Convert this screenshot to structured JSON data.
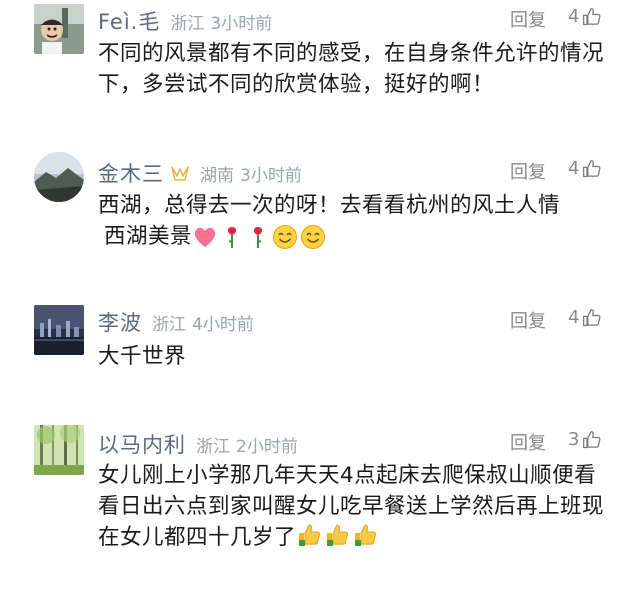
{
  "comments": [
    {
      "name": "Feì.毛",
      "location": "浙江",
      "time": "3小时前",
      "reply_label": "回复",
      "likes": "4",
      "text": "不同的风景都有不同的感受，在自身条件允许的情况下，多尝试不同的欣赏体验，挺好的啊！"
    },
    {
      "name": "金木三",
      "location": "湖南",
      "time": "3小时前",
      "reply_label": "回复",
      "likes": "4",
      "text_line1": "西湖，总得去一次的呀！去看看杭州的风土人情",
      "text_line2": "西湖美景",
      "emojis": [
        "heart",
        "rose",
        "rose",
        "smile",
        "smile"
      ]
    },
    {
      "name": "李波",
      "location": "浙江",
      "time": "4小时前",
      "reply_label": "回复",
      "likes": "4",
      "text": "大千世界"
    },
    {
      "name": "以马内利",
      "location": "浙江",
      "time": "2小时前",
      "reply_label": "回复",
      "likes": "3",
      "text": "女儿刚上小学那几年天天4点起床去爬保叔山顺便看看日出六点到家叫醒女儿吃早餐送上学然后再上班现在女儿都四十几岁了",
      "emojis": [
        "thumbs-up",
        "thumbs-up",
        "thumbs-up"
      ]
    }
  ],
  "colors": {
    "name": "#5c6b80",
    "meta": "#9ba3ad",
    "text": "#1a1a1a",
    "action": "#888888"
  }
}
